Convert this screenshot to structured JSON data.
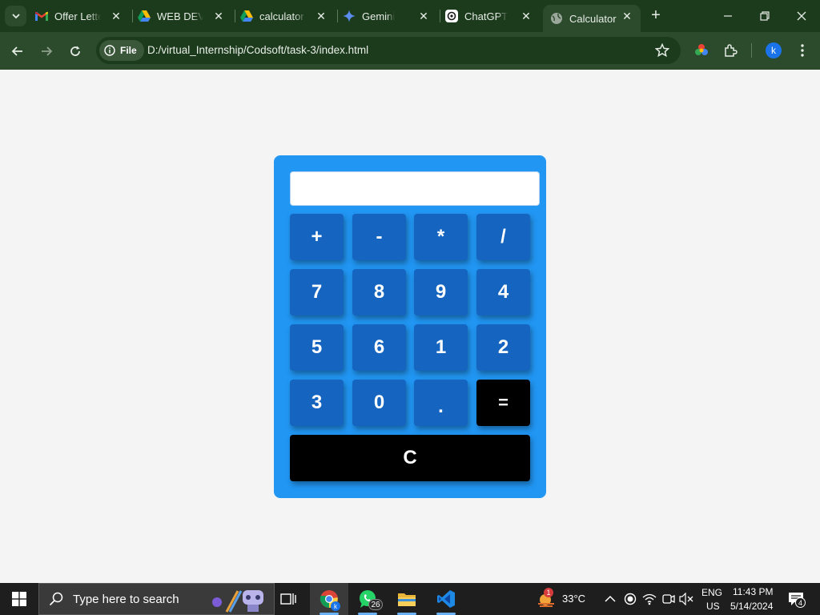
{
  "browser": {
    "tabs": [
      {
        "label": "Offer Letter",
        "icon": "gmail-icon"
      },
      {
        "label": "WEB DEV.pdf",
        "icon": "google-drive-icon"
      },
      {
        "label": "calculator c",
        "icon": "google-drive-icon"
      },
      {
        "label": "Gemini",
        "icon": "gemini-icon"
      },
      {
        "label": "ChatGPT",
        "icon": "chatgpt-icon"
      },
      {
        "label": "Calculator",
        "icon": "globe-icon",
        "active": true
      }
    ],
    "address_chip": "File",
    "url": "D:/virtual_Internship/Codsoft/task-3/index.html",
    "profile_initial": "k"
  },
  "calculator": {
    "display_value": "",
    "keys": [
      {
        "label": "+",
        "style": "blue"
      },
      {
        "label": "-",
        "style": "blue"
      },
      {
        "label": "*",
        "style": "blue"
      },
      {
        "label": "/",
        "style": "blue"
      },
      {
        "label": "7",
        "style": "blue"
      },
      {
        "label": "8",
        "style": "blue"
      },
      {
        "label": "9",
        "style": "blue"
      },
      {
        "label": "4",
        "style": "blue"
      },
      {
        "label": "5",
        "style": "blue"
      },
      {
        "label": "6",
        "style": "blue"
      },
      {
        "label": "1",
        "style": "blue"
      },
      {
        "label": "2",
        "style": "blue"
      },
      {
        "label": "3",
        "style": "blue"
      },
      {
        "label": "0",
        "style": "blue"
      },
      {
        "label": ".",
        "style": "blue"
      },
      {
        "label": "=",
        "style": "black"
      }
    ],
    "clear_label": "C",
    "colors": {
      "panel": "#2196f3",
      "key": "#1565c0",
      "dark_key": "#000000"
    }
  },
  "taskbar": {
    "search_placeholder": "Type here to search",
    "whatsapp_badge": "26",
    "weather_alert": "1",
    "temperature": "33°C",
    "language": "ENG",
    "region": "US",
    "time": "11:43 PM",
    "date": "5/14/2024",
    "notification_count": "4"
  }
}
